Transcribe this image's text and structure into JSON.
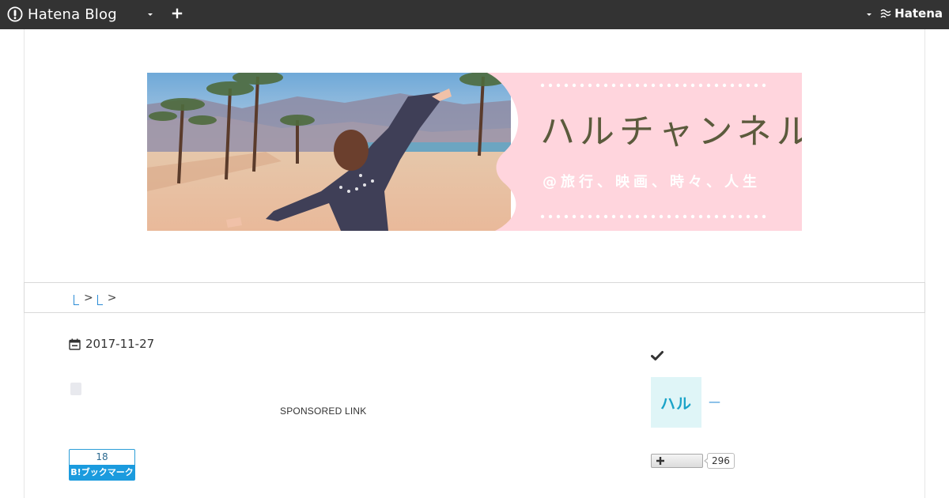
{
  "topbar": {
    "brand": "Hatena Blog",
    "right_brand": "Hatena"
  },
  "banner": {
    "title": "ハルチャンネル",
    "subtitle": "@旅行、映画、時々、人生"
  },
  "breadcrumb": {
    "separators": [
      ">",
      ">"
    ]
  },
  "article": {
    "date": "2017-11-27",
    "sponsored_label": "SPONSORED LINK",
    "bookmark_count": "18",
    "bookmark_label": "B!ブックマーク"
  },
  "sidebar": {
    "avatar_text": "ハル",
    "author_link": "—",
    "follower_count": "296"
  },
  "colors": {
    "topbar": "#333333",
    "banner_pink": "#ffd5dd",
    "banner_title": "#5b5a3c",
    "link_blue": "#2a8bd6",
    "hatebu_blue": "#1b9bde",
    "avatar_bg": "#dff5f7"
  }
}
